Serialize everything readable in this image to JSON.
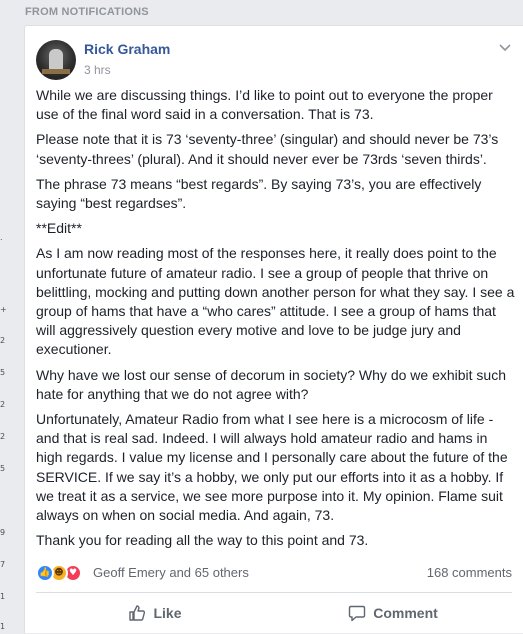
{
  "section": {
    "header": "FROM NOTIFICATIONS"
  },
  "left_strip": {
    "marks": [
      "+",
      "2",
      "5",
      "2",
      "2",
      "5",
      "9",
      "7",
      "1",
      "1"
    ]
  },
  "post": {
    "author": "Rick Graham",
    "timestamp": "3 hrs",
    "paragraphs": [
      "While we are discussing things. I’d like to point out to everyone the proper use of the final word said in a conversation. That is 73.",
      "Please note that it is 73 ‘seventy-three’ (singular) and should never be 73’s ‘seventy-threes’ (plural). And it should never ever be 73rds ‘seven thirds’.",
      "The phrase 73 means “best regards”. By saying 73’s, you are effectively saying “best regardses”.",
      "**Edit**",
      "As I am now reading most of the responses here, it really does point to the unfortunate future of amateur radio. I see a group of people that thrive on belittling, mocking and putting down another person for what they say. I see a group of hams that have a “who cares” attitude. I see a group of hams that will aggressively question every motive and love to be judge jury and executioner.",
      "Why have we lost our sense of decorum in society? Why do we exhibit such hate for anything that we do not agree with?",
      "Unfortunately, Amateur Radio from what I see here is a microcosm of life - and that is real sad. Indeed. I will always hold amateur radio and hams in high regards. I value my license and I personally care about the future of the SERVICE. If we say it’s a hobby, we only put our efforts into it as a hobby. If we treat it as a service, we see more purpose into it. My opinion. Flame suit always on when on social media. And again, 73.",
      "Thank you for reading all the way to this point and 73."
    ],
    "reactions": {
      "icons": [
        "like-icon",
        "haha-icon",
        "love-icon"
      ],
      "summary": "Geoff Emery and 65 others",
      "comments": "168 comments"
    },
    "actions": {
      "like": "Like",
      "comment": "Comment"
    }
  },
  "colors": {
    "author_link": "#365899",
    "background": "#e9ebee",
    "like_blue": "#2d88ff",
    "haha_yellow": "#f7b125",
    "love_red": "#f33e58",
    "muted_text": "#606770"
  }
}
